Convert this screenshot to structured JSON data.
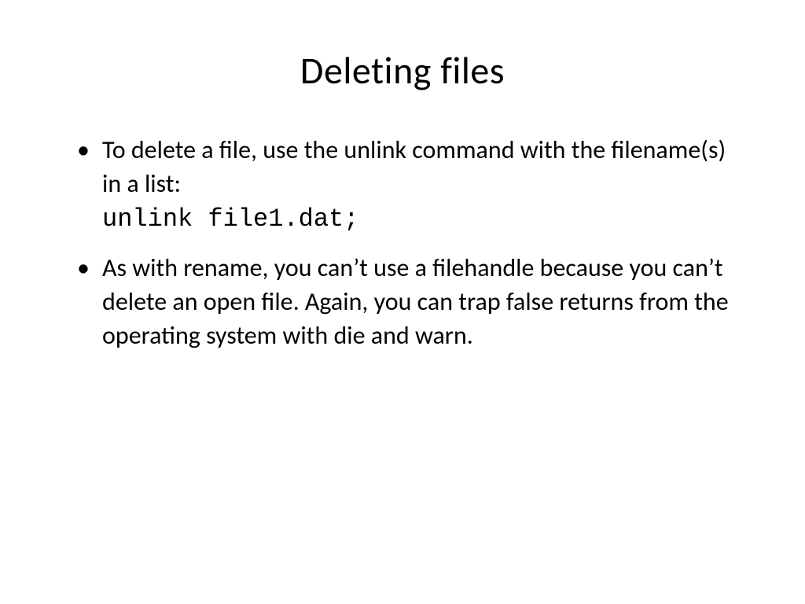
{
  "slide": {
    "title": "Deleting files",
    "bullets": [
      {
        "text": "To delete a file, use the unlink command with the filename(s) in a list:",
        "code": "unlink file1.dat;"
      },
      {
        "text": "As with rename, you can’t use a filehandle because you can’t delete an open file. Again, you can trap false returns from the operating system with die and warn."
      }
    ]
  }
}
